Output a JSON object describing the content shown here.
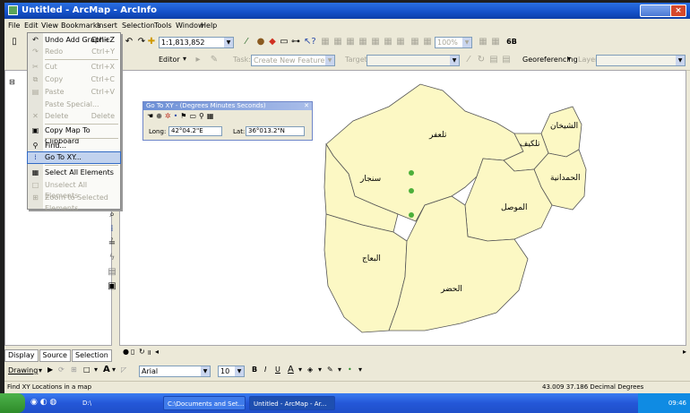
{
  "window": {
    "title": "Untitled - ArcMap - ArcInfo"
  },
  "menubar": [
    "File",
    "Edit",
    "View",
    "Bookmarks",
    "Insert",
    "Selection",
    "Tools",
    "Window",
    "Help"
  ],
  "toolbar": {
    "scale": "1:1,813,852",
    "zoom_percent": "100%",
    "editor_label": "Editor",
    "task_label": "Task:",
    "task_value": "Create New Feature",
    "target_label": "Target:",
    "georef_label": "Georeferencing",
    "layer_label": "Layer:"
  },
  "edit_menu": {
    "items": [
      {
        "label": "Undo Add Graphic",
        "shortcut": "Ctrl+Z",
        "icon": "undo-icon",
        "enabled": true
      },
      {
        "label": "Redo",
        "shortcut": "Ctrl+Y",
        "icon": "redo-icon",
        "enabled": false
      },
      {
        "label": "Cut",
        "shortcut": "Ctrl+X",
        "icon": "cut-icon",
        "enabled": false
      },
      {
        "label": "Copy",
        "shortcut": "Ctrl+C",
        "icon": "copy-icon",
        "enabled": false
      },
      {
        "label": "Paste",
        "shortcut": "Ctrl+V",
        "icon": "paste-icon",
        "enabled": false
      },
      {
        "label": "Paste Special...",
        "shortcut": "",
        "icon": "",
        "enabled": false
      },
      {
        "label": "Delete",
        "shortcut": "Delete",
        "icon": "delete-icon",
        "enabled": false
      },
      {
        "label": "Copy Map To Clipboard",
        "shortcut": "",
        "icon": "copy-map-icon",
        "enabled": true
      },
      {
        "label": "Find...",
        "shortcut": "",
        "icon": "binoculars-icon",
        "enabled": true
      },
      {
        "label": "Go To XY...",
        "shortcut": "",
        "icon": "goto-xy-icon",
        "enabled": true
      },
      {
        "label": "Select All Elements",
        "shortcut": "",
        "icon": "select-all-icon",
        "enabled": true
      },
      {
        "label": "Unselect All Elements",
        "shortcut": "",
        "icon": "unselect-icon",
        "enabled": false
      },
      {
        "label": "Zoom to Selected Elements",
        "shortcut": "",
        "icon": "zoom-selected-icon",
        "enabled": false
      }
    ]
  },
  "goto_xy": {
    "title": "Go To XY - (Degrees Minutes Seconds)",
    "long_label": "Long:",
    "long_value": "42°04.2\"E",
    "lat_label": "Lat:",
    "lat_value": "36°013.2\"N"
  },
  "map": {
    "districts": [
      "تلعفر",
      "الشيخان",
      "تلكيف",
      "الحمدانية",
      "سنجار",
      "الموصل",
      "البعاج",
      "الحضر"
    ],
    "fill_color": "#fcf8c4",
    "point_color": "#4caf3a"
  },
  "toc_tabs": [
    "Display",
    "Source",
    "Selection"
  ],
  "drawing": {
    "label": "Drawing",
    "font": "Arial",
    "size": "10"
  },
  "status": {
    "left": "Find XY Locations in a map",
    "coords": "43.009  37.186 Decimal Degrees"
  },
  "taskbar": {
    "items": [
      "D:\\",
      "C:\\Documents and Set...",
      "Untitled - ArcMap - Ar..."
    ],
    "clock": "09:46"
  }
}
